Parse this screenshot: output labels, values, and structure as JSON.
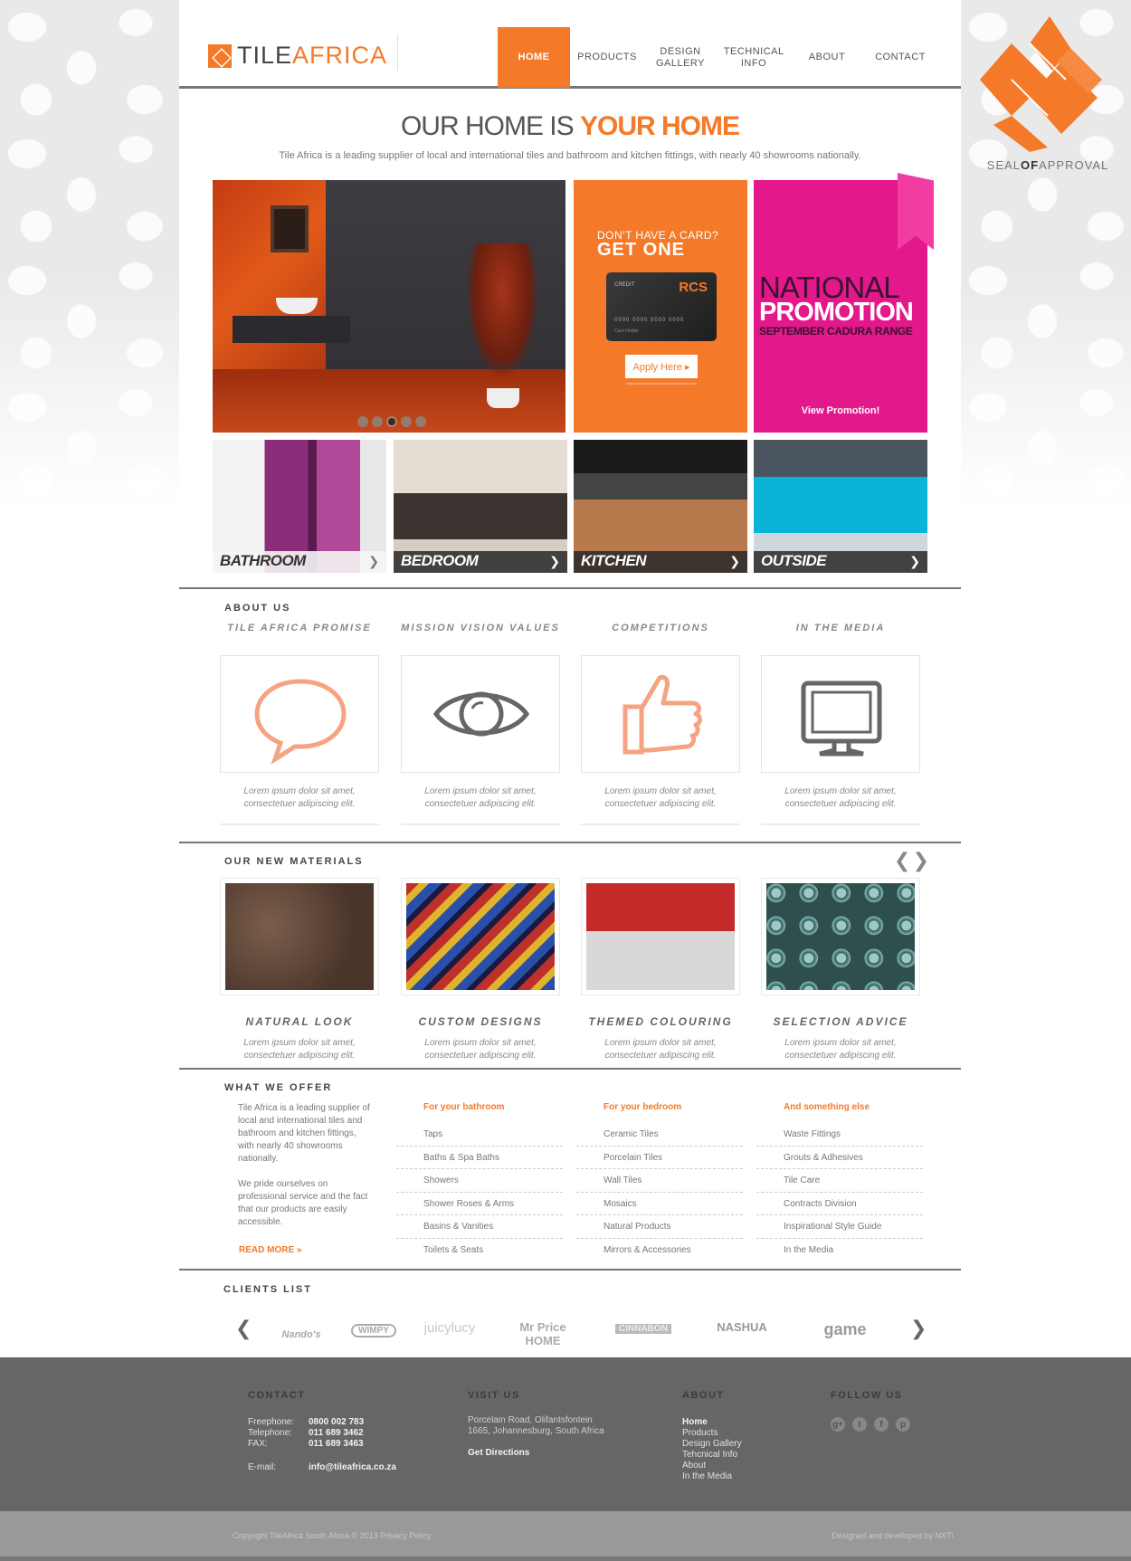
{
  "brand": {
    "logo_main": "TILE",
    "logo_accent": "AFRICA"
  },
  "nav": {
    "items": [
      {
        "label": "HOME",
        "active": true
      },
      {
        "label": "PRODUCTS"
      },
      {
        "label": "DESIGN GALLERY"
      },
      {
        "label": "TECHNICAL INFO"
      },
      {
        "label": "ABOUT"
      },
      {
        "label": "CONTACT"
      }
    ]
  },
  "seal": {
    "part1": "SEAL",
    "part2": "OF",
    "part3": "APPROVAL"
  },
  "hero": {
    "title_plain": "OUR HOME IS",
    "title_accent": "YOUR HOME",
    "subtitle": "Tile Africa is a leading supplier of local and international tiles and bathroom and kitchen fittings, with nearly 40 showrooms nationally."
  },
  "card_promo": {
    "question": "DON'T HAVE A CARD?",
    "headline": "GET ONE",
    "card_label": "CREDIT",
    "card_brand": "RCS",
    "card_number": "0000 0000 0000 0000",
    "card_holder": "Card Holder",
    "button": "Apply Here ▸"
  },
  "national_promo": {
    "line1": "NATIONAL",
    "line2": "PROMOTION",
    "line3": "SEPTEMBER CADURA RANGE",
    "link": "View Promotion!"
  },
  "rooms": [
    {
      "name": "BATHROOM"
    },
    {
      "name": "BEDROOM"
    },
    {
      "name": "KITCHEN"
    },
    {
      "name": "OUTSIDE"
    }
  ],
  "about": {
    "title": "ABOUT US",
    "items": [
      {
        "head": "TILE AFRICA PROMISE",
        "text": "Lorem ipsum dolor sit amet, consectetuer adipiscing elit.",
        "icon": "speech-bubble-icon"
      },
      {
        "head": "MISSION VISION VALUES",
        "text": "Lorem ipsum dolor sit amet, consectetuer adipiscing elit.",
        "icon": "eye-icon"
      },
      {
        "head": "COMPETITIONS",
        "text": "Lorem ipsum dolor sit amet, consectetuer adipiscing elit.",
        "icon": "thumbs-up-icon"
      },
      {
        "head": "IN THE MEDIA",
        "text": "Lorem ipsum dolor sit amet, consectetuer adipiscing elit.",
        "icon": "monitor-icon"
      }
    ]
  },
  "materials": {
    "title": "OUR NEW MATERIALS",
    "items": [
      {
        "head": "NATURAL LOOK",
        "text": "Lorem ipsum dolor sit amet, consectetuer adipiscing elit."
      },
      {
        "head": "CUSTOM DESIGNS",
        "text": "Lorem ipsum dolor sit amet, consectetuer adipiscing elit."
      },
      {
        "head": "THEMED COLOURING",
        "text": "Lorem ipsum dolor sit amet, consectetuer adipiscing elit."
      },
      {
        "head": "SELECTION ADVICE",
        "text": "Lorem ipsum dolor sit amet, consectetuer adipiscing elit."
      }
    ]
  },
  "offer": {
    "title": "WHAT WE OFFER",
    "intro_p1": "Tile Africa is a leading supplier of local and international tiles and bathroom and kitchen fittings, with nearly 40 showrooms nationally.",
    "intro_p2": "We pride ourselves on professional service and the fact that our products are easily accessible.",
    "read_more": "READ MORE »",
    "columns": [
      {
        "head": "For your bathroom",
        "items": [
          "Taps",
          "Baths & Spa Baths",
          "Showers",
          "Shower Roses & Arms",
          "Basins & Vanities",
          "Toilets & Seats"
        ]
      },
      {
        "head": "For your bedroom",
        "items": [
          "Ceramic Tiles",
          "Porcelain Tiles",
          "Wall Tiles",
          "Mosaics",
          "Natural Products",
          "Mirrors & Accessories"
        ]
      },
      {
        "head": "And something else",
        "items": [
          "Waste Fittings",
          "Grouts & Adhesives",
          "Tile Care",
          "Contracts Division",
          "Inspirational Style Guide",
          "In the Media"
        ]
      }
    ]
  },
  "clients": {
    "title": "CLIENTS LIST",
    "logos": [
      "Nando's",
      "WIMPY",
      "juicylucy",
      "Mr Price HOME",
      "CINNABON",
      "NASHUA",
      "game"
    ]
  },
  "footer": {
    "contact_title": "CONTACT",
    "freephone_label": "Freephone:",
    "freephone": "0800 002 783",
    "telephone_label": "Telephone:",
    "telephone": "011 689 3462",
    "fax_label": "FAX:",
    "fax": "011 689 3463",
    "email_label": "E-mail:",
    "email": "info@tileafrica.co.za",
    "visit_title": "VISIT US",
    "address1": "Porcelain Road, Olifantsfontein",
    "address2": "1665, Johannesburg, South Africa",
    "directions": "Get Directions",
    "about_title": "ABOUT",
    "about_links": [
      "Home",
      "Products",
      "Design Gallery",
      "Tehcnical Info",
      "About",
      "In the Media"
    ],
    "follow_title": "FOLLOW US",
    "copyright": "Copyright TileAfrica South Africa © 2013 Privacy Policy",
    "credit": "Designed and developed by NXT\\"
  },
  "colors": {
    "accent": "#f47a2a",
    "promo_pink": "#e2188b",
    "footer": "#666666"
  }
}
